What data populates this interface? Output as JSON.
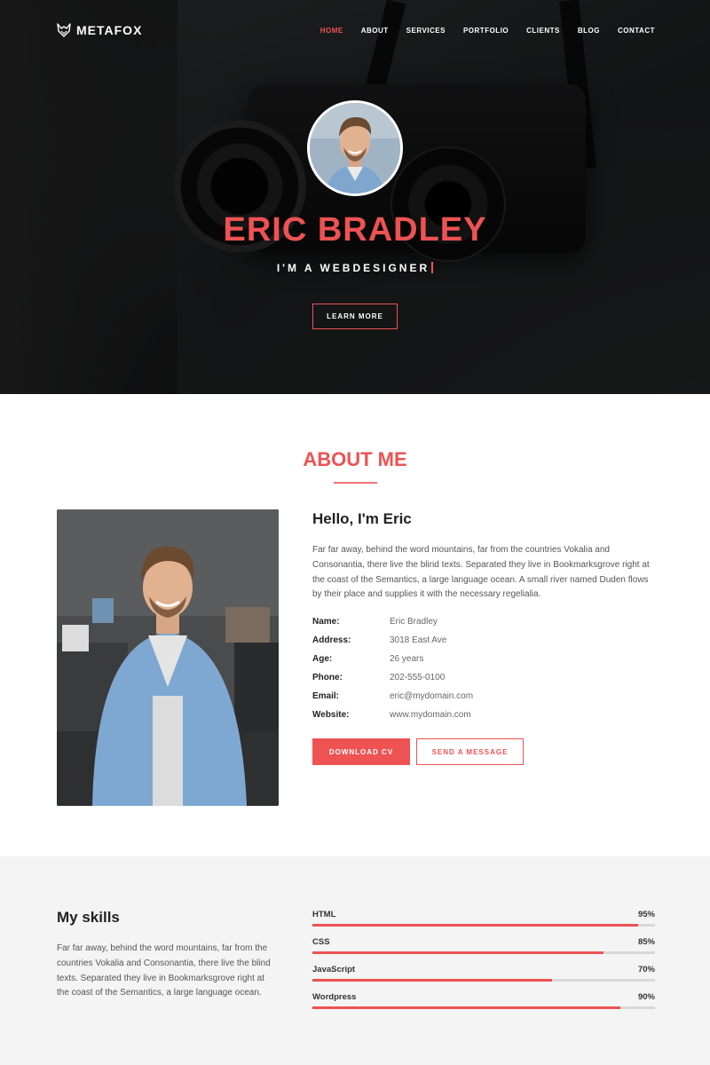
{
  "brand": {
    "name": "METAFOX",
    "accent": "#ee5253"
  },
  "nav": {
    "items": [
      {
        "label": "HOME",
        "active": true
      },
      {
        "label": "ABOUT",
        "active": false
      },
      {
        "label": "SERVICES",
        "active": false
      },
      {
        "label": "PORTFOLIO",
        "active": false
      },
      {
        "label": "CLIENTS",
        "active": false
      },
      {
        "label": "BLOG",
        "active": false
      },
      {
        "label": "CONTACT",
        "active": false
      }
    ]
  },
  "hero": {
    "name": "ERIC BRADLEY",
    "role": "I'M A WEBDESIGNER",
    "cta": "LEARN MORE"
  },
  "about": {
    "title": "ABOUT ME",
    "greeting": "Hello, I'm Eric",
    "text": "Far far away, behind the word mountains, far from the countries Vokalia and Consonantia, there live the blind texts. Separated they live in Bookmarksgrove right at the coast of the Semantics, a large language ocean. A small river named Duden flows by their place and supplies it with the necessary regelialia.",
    "details": [
      {
        "label": "Name:",
        "value": "Eric Bradley"
      },
      {
        "label": "Address:",
        "value": "3018 East Ave"
      },
      {
        "label": "Age:",
        "value": "26 years"
      },
      {
        "label": "Phone:",
        "value": "202-555-0100"
      },
      {
        "label": "Email:",
        "value": "eric@mydomain.com"
      },
      {
        "label": "Website:",
        "value": "www.mydomain.com"
      }
    ],
    "download_label": "DOWNLOAD CV",
    "message_label": "SEND A MESSAGE"
  },
  "skills": {
    "title": "My skills",
    "text": "Far far away, behind the word mountains, far from the countries Vokalia and Consonantia, there live the blind texts. Separated they live in Bookmarksgrove right at the coast of the Semantics, a large language ocean.",
    "items": [
      {
        "name": "HTML",
        "percent_label": "95%",
        "level": 0.95
      },
      {
        "name": "CSS",
        "percent_label": "85%",
        "level": 0.85
      },
      {
        "name": "JavaScript",
        "percent_label": "70%",
        "level": 0.7
      },
      {
        "name": "Wordpress",
        "percent_label": "90%",
        "level": 0.9
      }
    ]
  }
}
